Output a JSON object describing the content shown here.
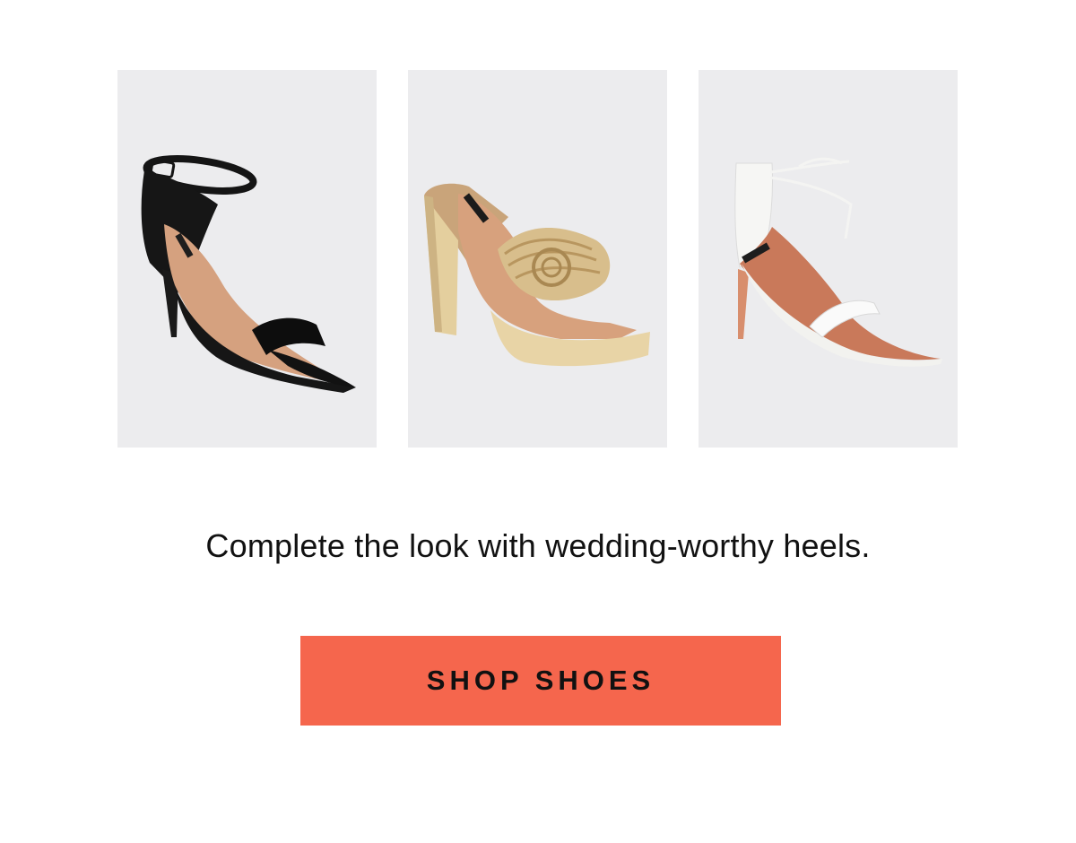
{
  "products": [
    {
      "name": "black-ankle-strap-heel",
      "icon": "black-heel-sandal-image",
      "color": "#111111"
    },
    {
      "name": "gold-knotted-platform-heel",
      "icon": "gold-platform-sandal-image",
      "color": "#d9bf8e"
    },
    {
      "name": "white-tie-up-heel",
      "icon": "white-heel-sandal-image",
      "color": "#f7f7f5"
    }
  ],
  "tagline": "Complete the look with wedding-worthy heels.",
  "cta": {
    "label": "SHOP SHOES",
    "color": "#f5664d"
  }
}
